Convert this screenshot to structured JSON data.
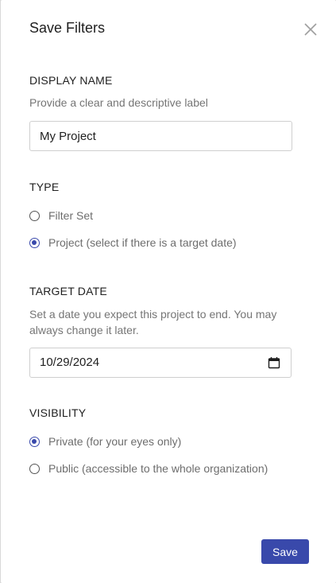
{
  "dialog": {
    "title": "Save Filters"
  },
  "display_name": {
    "label": "DISPLAY NAME",
    "hint": "Provide a clear and descriptive label",
    "value": "My Project"
  },
  "type": {
    "label": "TYPE",
    "options": [
      {
        "label": "Filter Set",
        "checked": false
      },
      {
        "label": "Project (select if there is a target date)",
        "checked": true
      }
    ]
  },
  "target_date": {
    "label": "TARGET DATE",
    "hint": "Set a date you expect this project to end. You may always change it later.",
    "value": "10/29/2024"
  },
  "visibility": {
    "label": "VISIBILITY",
    "options": [
      {
        "label": "Private (for your eyes only)",
        "checked": true
      },
      {
        "label": "Public (accessible to the whole organization)",
        "checked": false
      }
    ]
  },
  "actions": {
    "save_label": "Save"
  },
  "colors": {
    "accent": "#3949ab"
  },
  "icons": {
    "close": "close-icon",
    "calendar": "calendar-icon"
  }
}
